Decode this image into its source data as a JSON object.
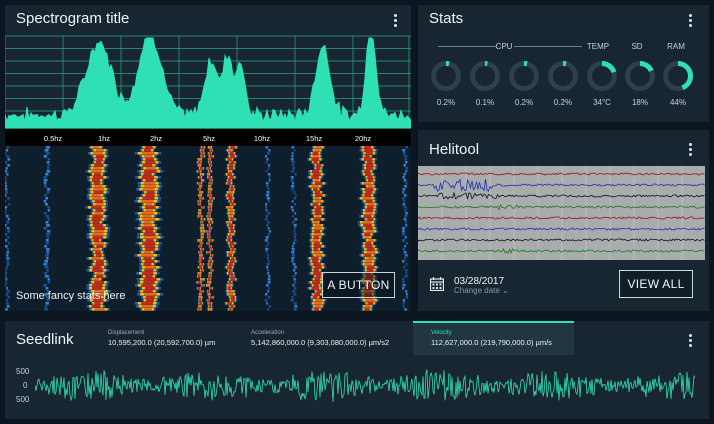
{
  "spectrogram": {
    "title": "Spectrogram title",
    "freq_labels": [
      "0.5hz",
      "1hz",
      "2hz",
      "5hz",
      "10hz",
      "15hz",
      "20hz"
    ],
    "fancy_text": "Some fancy stats here",
    "button_label": "A BUTTON"
  },
  "stats": {
    "title": "Stats",
    "group_label": "CPU",
    "headers": {
      "temp": "TEMP",
      "sd": "SD",
      "ram": "RAM"
    },
    "gauges": [
      {
        "id": "cpu1",
        "value": "0.2%",
        "fraction": 0.04
      },
      {
        "id": "cpu2",
        "value": "0.1%",
        "fraction": 0.03
      },
      {
        "id": "cpu3",
        "value": "0.2%",
        "fraction": 0.04
      },
      {
        "id": "cpu4",
        "value": "0.2%",
        "fraction": 0.04
      },
      {
        "id": "temp",
        "value": "34°C",
        "fraction": 0.2
      },
      {
        "id": "sd",
        "value": "18%",
        "fraction": 0.18
      },
      {
        "id": "ram",
        "value": "44%",
        "fraction": 0.44
      }
    ]
  },
  "helitool": {
    "title": "Helitool",
    "date": "03/28/2017",
    "date_action": "Change date",
    "button_label": "VIEW ALL"
  },
  "seedlink": {
    "title": "Seedlink",
    "metrics": [
      {
        "label": "Displacement",
        "value": "10,595,200.0 (20,592,700.0) µm"
      },
      {
        "label": "Acceleration",
        "value": "5,142,860,000.0 (9,303,080,000.0) µm/s2"
      },
      {
        "label": "Velocity",
        "value": "112,627,000.0 (219,790,000.0) µm/s"
      }
    ],
    "y_labels": [
      "500",
      "0",
      "500"
    ]
  },
  "colors": {
    "accent": "#2fe0b6",
    "card": "#172631",
    "background": "#0b1620"
  },
  "icons": {
    "menu": "more-vert-icon",
    "calendar": "calendar-icon",
    "chevron": "chevron-down-icon"
  }
}
